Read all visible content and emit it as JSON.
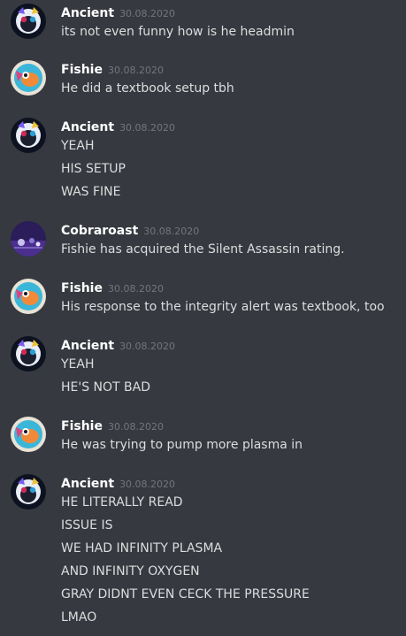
{
  "messages": [
    {
      "author": "Ancient",
      "time": "30.08.2020",
      "avatar": "raccoon-avatar-icon",
      "lines": [
        "its not even funny how is he headmin"
      ]
    },
    {
      "author": "Fishie",
      "time": "30.08.2020",
      "avatar": "fish-avatar-icon",
      "lines": [
        "He did a textbook setup tbh"
      ]
    },
    {
      "author": "Ancient",
      "time": "30.08.2020",
      "avatar": "raccoon-avatar-icon",
      "lines": [
        "YEAH",
        "HIS SETUP",
        "WAS FINE"
      ]
    },
    {
      "author": "Cobraroast",
      "time": "30.08.2020",
      "avatar": "purple-scene-avatar-icon",
      "lines": [
        "Fishie has acquired the Silent Assassin rating."
      ]
    },
    {
      "author": "Fishie",
      "time": "30.08.2020",
      "avatar": "fish-avatar-icon",
      "lines": [
        "His response to the integrity alert was textbook, too"
      ]
    },
    {
      "author": "Ancient",
      "time": "30.08.2020",
      "avatar": "raccoon-avatar-icon",
      "lines": [
        "YEAH",
        "HE'S NOT BAD"
      ]
    },
    {
      "author": "Fishie",
      "time": "30.08.2020",
      "avatar": "fish-avatar-icon",
      "lines": [
        "He was trying to pump more plasma in"
      ]
    },
    {
      "author": "Ancient",
      "time": "30.08.2020",
      "avatar": "raccoon-avatar-icon",
      "lines": [
        "HE LITERALLY READ",
        "ISSUE IS",
        "WE HAD INFINITY PLASMA",
        "AND INFINITY OXYGEN",
        "GRAY DIDNT EVEN CECK THE PRESSURE",
        "LMAO"
      ]
    }
  ]
}
